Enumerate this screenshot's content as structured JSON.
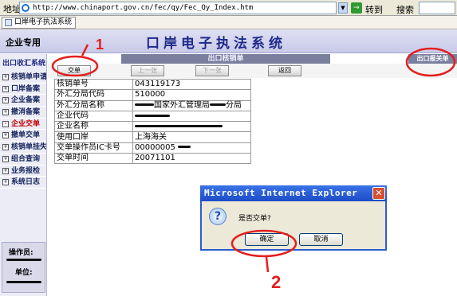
{
  "browser": {
    "address_label": "地址",
    "url": "http://www.chinaport.gov.cn/fec/qy/Fec_Qy_Index.htm",
    "go_label": "转到",
    "search_label": "搜索",
    "tab_title": "口岸电子执法系统"
  },
  "header": {
    "company": "企业专用",
    "system_title": "口岸电子执法系统"
  },
  "sidebar": {
    "title": "出口收汇系统",
    "items": [
      {
        "label": "核销单申请",
        "mark": "+"
      },
      {
        "label": "口岸备案",
        "mark": "+"
      },
      {
        "label": "企业备案",
        "mark": "+"
      },
      {
        "label": "撤消备案",
        "mark": "+"
      },
      {
        "label": "企业交单",
        "mark": "-"
      },
      {
        "label": "撤单交单",
        "mark": "+"
      },
      {
        "label": "核销单挂失",
        "mark": "+"
      },
      {
        "label": "组合查询",
        "mark": "+"
      },
      {
        "label": "业务报检",
        "mark": "+"
      },
      {
        "label": "系统日志",
        "mark": "+"
      }
    ],
    "operator_label": "操作员:",
    "unit_label": "单位:"
  },
  "main": {
    "section_title": "出口核销单",
    "export_section": "出口报关单",
    "toolbar": {
      "submit": "交单",
      "prev": "上一张",
      "next": "下一张",
      "back": "返回"
    },
    "rows": [
      {
        "label": "核销单号",
        "value": "043119173"
      },
      {
        "label": "外汇分局代码",
        "value": "510000"
      },
      {
        "label": "外汇分局名称",
        "value": "国家外汇管理局",
        "suffix": "分局"
      },
      {
        "label": "企业代码",
        "value": ""
      },
      {
        "label": "企业名称",
        "value": ""
      },
      {
        "label": "使用口岸",
        "value": "上海海关"
      },
      {
        "label": "交单操作员IC卡号",
        "value": "00000005"
      },
      {
        "label": "交单时间",
        "value": "20071101"
      }
    ]
  },
  "dialog": {
    "title": "Microsoft Internet Explorer",
    "message": "是否交单?",
    "ok": "确定",
    "cancel": "取消"
  },
  "annotations": {
    "step1": "1",
    "step2": "2",
    "color": "#e41e1e"
  }
}
